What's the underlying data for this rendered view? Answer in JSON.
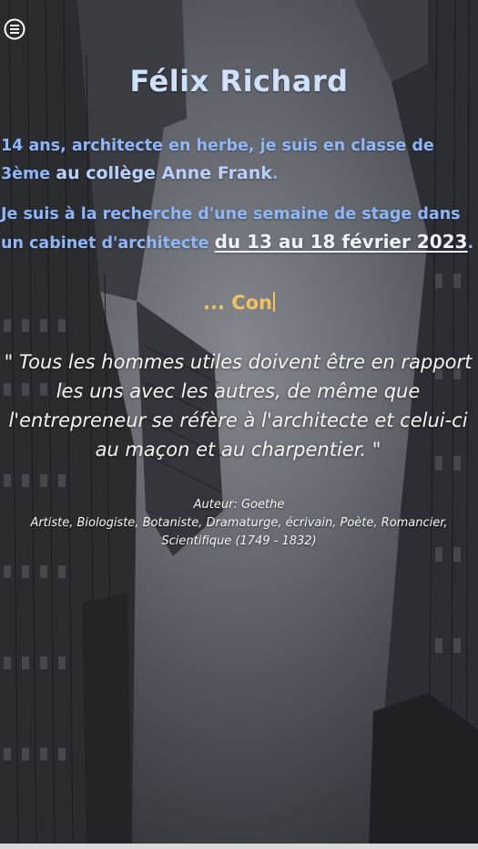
{
  "header": {
    "menu_icon": "hamburger-menu-icon",
    "name": "Félix Richard"
  },
  "intro": {
    "line1_part1": "14 ans, architecte en herbe, je suis en classe de 3ème ",
    "line1_part2": "au collège Anne Frank",
    "line1_end": ".",
    "line2_part1": "Je suis à la recherche d'une semaine de stage dans un cabinet d'architecte ",
    "dates_link": "du 13 au 18 février 2023",
    "line2_end": "."
  },
  "typed_text": "... Con",
  "quote": {
    "text": "\" Tous les hommes utiles doivent être en rapport les uns avec les autres, de même que l'entrepreneur se réfère à l'architecte et celui-ci au maçon et au charpentier. \"",
    "author": "Auteur: Goethe",
    "roles": "Artiste, Biologiste, Botaniste, Dramaturge, écrivain, Poète, Romancier, Scientifique (1749 - 1832)"
  },
  "colors": {
    "title": "#cfe0fb",
    "intro": "#8fb6f7",
    "typed": "#f2c15b",
    "quote": "#f4f4f4"
  }
}
